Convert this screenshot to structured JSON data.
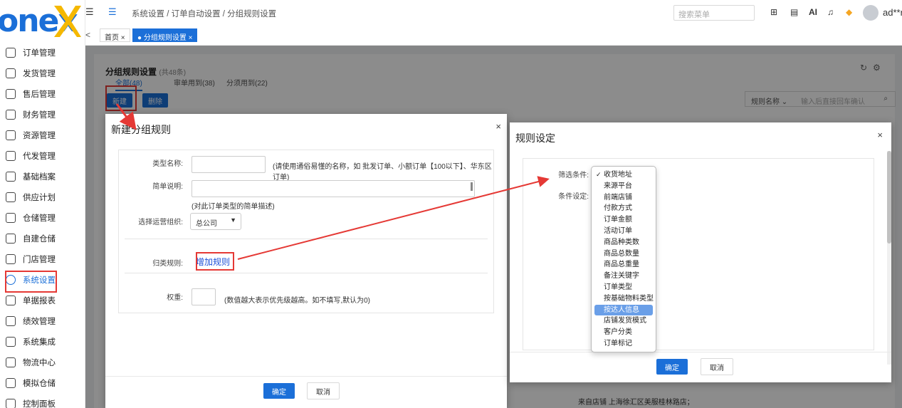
{
  "logo": "onex",
  "sidebar": {
    "items": [
      {
        "label": "订单管理",
        "icon": "order-icon"
      },
      {
        "label": "发货管理",
        "icon": "shipping-icon"
      },
      {
        "label": "售后管理",
        "icon": "after-sales-icon"
      },
      {
        "label": "财务管理",
        "icon": "finance-icon"
      },
      {
        "label": "资源管理",
        "icon": "resource-icon"
      },
      {
        "label": "代发管理",
        "icon": "dropship-icon"
      },
      {
        "label": "基础档案",
        "icon": "archive-icon"
      },
      {
        "label": "供应计划",
        "icon": "supply-plan-icon"
      },
      {
        "label": "仓储管理",
        "icon": "warehouse-icon"
      },
      {
        "label": "自建仓储",
        "icon": "self-warehouse-icon"
      },
      {
        "label": "门店管理",
        "icon": "store-icon"
      },
      {
        "label": "系统设置",
        "icon": "settings-icon"
      },
      {
        "label": "单据报表",
        "icon": "report-icon"
      },
      {
        "label": "绩效管理",
        "icon": "performance-icon"
      },
      {
        "label": "系统集成",
        "icon": "integration-icon"
      },
      {
        "label": "物流中心",
        "icon": "logistics-icon"
      },
      {
        "label": "模拟仓储",
        "icon": "simulated-warehouse-icon"
      },
      {
        "label": "控制面板",
        "icon": "dashboard-icon"
      }
    ],
    "active_index": 11
  },
  "header": {
    "breadcrumb": "系统设置 / 订单自动设置 / 分组规则设置",
    "search_placeholder": "搜索菜单",
    "tool_ai": "AI",
    "user": "ad**r"
  },
  "tabs": [
    {
      "label": "首页 ×"
    },
    {
      "label": "● 分组规则设置 ×"
    }
  ],
  "page": {
    "title": "分组规则设置",
    "count": "(共48条)",
    "subtabs": [
      {
        "label": "全部(48)"
      },
      {
        "label": "审单用到(38)"
      },
      {
        "label": "分须用到(22)"
      }
    ],
    "new_button": "新建",
    "delete_button": "删除",
    "filter_field": "规则名称 ⌄",
    "filter_placeholder": "输入后直接回车确认",
    "bottom_text": "来自店铺 上海徐汇区美服桂林路店；"
  },
  "modal1": {
    "title": "新建分组规则",
    "type_name_label": "类型名称:",
    "type_name_hint": "(请使用通俗易懂的名称，如 批发订单、小额订单【100以下】、华东区订单)",
    "desc_label": "简单说明:",
    "desc_hint": "(对此订单类型的简单描述)",
    "org_label": "选择运营组织:",
    "org_value": "总公司",
    "rule_label": "归类规则:",
    "add_rule": "增加规则",
    "weight_label": "权重:",
    "weight_hint": "(数值越大表示优先级越高。如不填写,默认为0)",
    "ok": "确定",
    "cancel": "取消"
  },
  "modal2": {
    "title": "规则设定",
    "filter_label": "筛选条件:",
    "condition_label": "条件设定:",
    "ok": "确定",
    "cancel": "取消"
  },
  "dropdown": {
    "options": [
      "收货地址",
      "来源平台",
      "前端店铺",
      "付款方式",
      "订单金额",
      "活动订单",
      "商品种类数",
      "商品总数量",
      "商品总重量",
      "备注关键字",
      "订单类型",
      "按基础物料类型",
      "按达人信息",
      "店铺发货模式",
      "客户分类",
      "订单标记"
    ],
    "checked_index": 0,
    "highlighted_index": 12
  },
  "colors": {
    "accent": "#1b6fd8",
    "annotation": "#e53935"
  }
}
